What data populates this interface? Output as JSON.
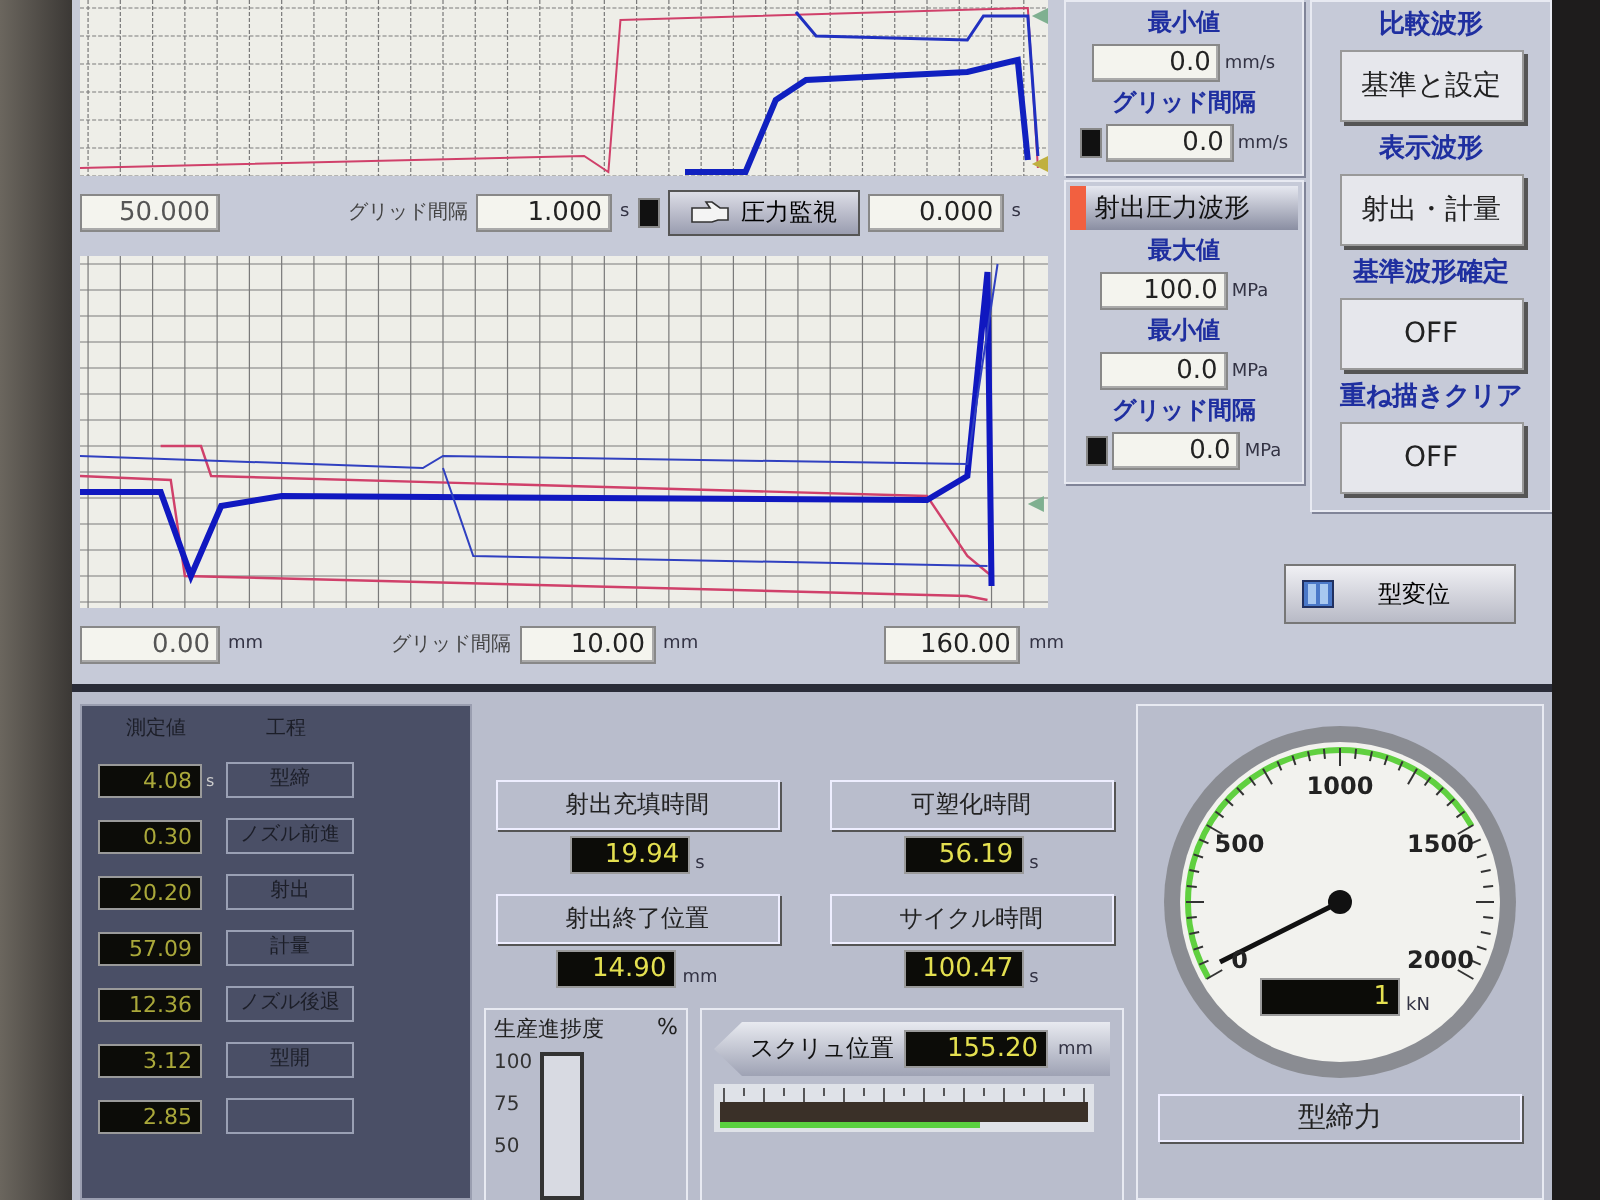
{
  "velocity_scale": {
    "min_label": "最小値",
    "min_value": "0.0",
    "min_unit": "mm/s",
    "grid_label": "グリッド間隔",
    "grid_value": "0.0",
    "grid_unit": "mm/s"
  },
  "time_axis": {
    "start": "50.000",
    "grid_label": "グリッド間隔",
    "grid_value": "1.000",
    "grid_unit": "s",
    "monitor_button": "圧力監視",
    "end": "0.000",
    "end_unit": "s"
  },
  "pressure_scale": {
    "title": "射出圧力波形",
    "max_label": "最大値",
    "max_value": "100.0",
    "max_unit": "MPa",
    "min_label": "最小値",
    "min_value": "0.0",
    "min_unit": "MPa",
    "grid_label": "グリッド間隔",
    "grid_value": "0.0",
    "grid_unit": "MPa"
  },
  "position_axis": {
    "start": "0.00",
    "start_unit": "mm",
    "grid_label": "グリッド間隔",
    "grid_value": "10.00",
    "grid_unit": "mm",
    "end": "160.00",
    "end_unit": "mm"
  },
  "waveform_controls": [
    {
      "label": "比較波形",
      "button": "基準と設定"
    },
    {
      "label": "表示波形",
      "button": "射出・計量"
    },
    {
      "label": "基準波形確定",
      "button": "OFF"
    },
    {
      "label": "重ね描きクリア",
      "button": "OFF"
    }
  ],
  "mold_displacement_button": "型変位",
  "process_table": {
    "columns": [
      "測定値",
      "工程"
    ],
    "rows": [
      {
        "value": "4.08",
        "unit": "s",
        "step": "型締"
      },
      {
        "value": "0.30",
        "step": "ノズル前進"
      },
      {
        "value": "20.20",
        "step": "射出"
      },
      {
        "value": "57.09",
        "step": "計量"
      },
      {
        "value": "12.36",
        "step": "ノズル後退"
      },
      {
        "value": "3.12",
        "step": "型開"
      },
      {
        "value": "2.85"
      }
    ]
  },
  "times": [
    {
      "label": "射出充填時間",
      "value": "19.94",
      "unit": "s"
    },
    {
      "label": "可塑化時間",
      "value": "56.19",
      "unit": "s"
    },
    {
      "label": "射出終了位置",
      "value": "14.90",
      "unit": "mm"
    },
    {
      "label": "サイクル時間",
      "value": "100.47",
      "unit": "s"
    }
  ],
  "progress": {
    "title": "生産進捗度",
    "unit": "%",
    "scale": [
      "100",
      "75",
      "50"
    ],
    "level": 0.0
  },
  "screw": {
    "label": "スクリュ位置",
    "value": "155.20",
    "unit": "mm"
  },
  "clamp_force": {
    "scale": [
      "0",
      "500",
      "1000",
      "1500",
      "2000"
    ],
    "value": "1",
    "unit": "kN",
    "label": "型締力"
  }
}
